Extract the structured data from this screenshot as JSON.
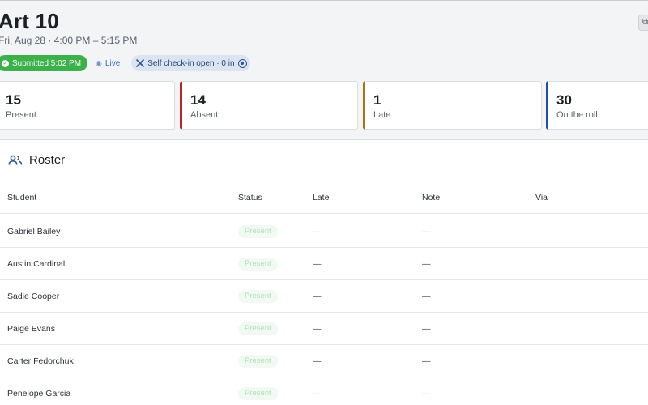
{
  "header": {
    "title": "Art 10",
    "subtitle": "Fri, Aug 28 · 4:00 PM – 5:15 PM"
  },
  "badges": {
    "submitted": "Submitted 5:02 PM",
    "live": "Live",
    "self_checkin": "Self check-in open · 0 in"
  },
  "stats": [
    {
      "value": "15",
      "label": "Present",
      "color": ""
    },
    {
      "value": "14",
      "label": "Absent",
      "color": "#b3262c"
    },
    {
      "value": "1",
      "label": "Late",
      "color": "#b07210"
    },
    {
      "value": "30",
      "label": "On the roll",
      "color": "#1f4fa0"
    }
  ],
  "roster": {
    "title": "Roster",
    "columns": [
      "Student",
      "Status",
      "Late",
      "Note",
      "Via"
    ],
    "rows": [
      {
        "student": "Gabriel Bailey",
        "status": "Present",
        "late": "—",
        "note": "—",
        "via": ""
      },
      {
        "student": "Austin Cardinal",
        "status": "Present",
        "late": "—",
        "note": "—",
        "via": ""
      },
      {
        "student": "Sadie Cooper",
        "status": "Present",
        "late": "—",
        "note": "—",
        "via": ""
      },
      {
        "student": "Paige Evans",
        "status": "Present",
        "late": "—",
        "note": "—",
        "via": ""
      },
      {
        "student": "Carter Fedorchuk",
        "status": "Present",
        "late": "—",
        "note": "—",
        "via": ""
      },
      {
        "student": "Penelope Garcia",
        "status": "Present",
        "late": "—",
        "note": "—",
        "via": ""
      }
    ]
  },
  "icons": {
    "submitted": "check-circle-icon",
    "live": "broadcast-icon",
    "self_checkin": "sparkle-icon",
    "roster": "users-icon",
    "corner": "export-icon"
  }
}
